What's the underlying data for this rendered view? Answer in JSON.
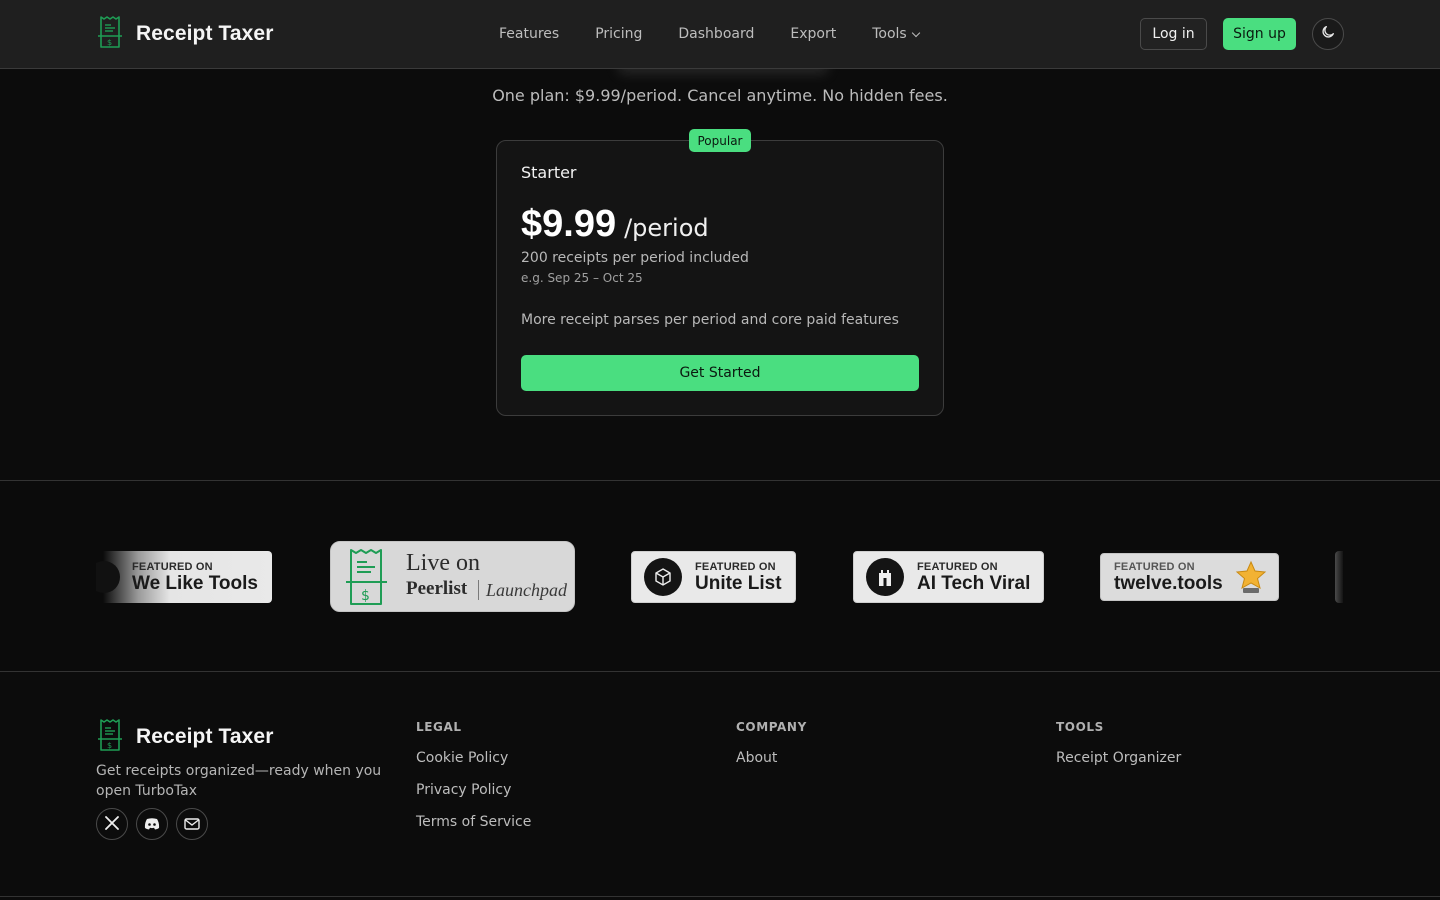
{
  "nav": {
    "brand": "Receipt Taxer",
    "links": [
      "Features",
      "Pricing",
      "Dashboard",
      "Export",
      "Tools"
    ],
    "login": "Log in",
    "signup": "Sign up",
    "theme_icon": "moon-icon"
  },
  "pricing": {
    "subtitle": "One plan: $9.99/period. Cancel anytime. No hidden fees.",
    "badge": "Popular",
    "plan": "Starter",
    "price": "$9.99",
    "period": "/period",
    "included": "200 receipts per period included",
    "example": "e.g. Sep 25 – Oct 25",
    "features": "More receipt parses per period and core paid features",
    "cta": "Get Started"
  },
  "featured": {
    "welike": {
      "small": "FEATURED ON",
      "big": "We Like Tools"
    },
    "peerlist": {
      "live": "Live on",
      "name": "Peerlist",
      "launch": "Launchpad"
    },
    "unite": {
      "small": "FEATURED ON",
      "big": "Unite List"
    },
    "aitech": {
      "small": "FEATURED ON",
      "big": "AI Tech Viral"
    },
    "twelve": {
      "small": "FEATURED ON",
      "big": "twelve.tools"
    }
  },
  "footer": {
    "brand": "Receipt Taxer",
    "tagline": "Get receipts organized—ready when you open TurboTax",
    "socials": [
      "x-icon",
      "discord-icon",
      "mail-icon"
    ],
    "legal": {
      "heading": "LEGAL",
      "links": [
        "Cookie Policy",
        "Privacy Policy",
        "Terms of Service"
      ]
    },
    "company": {
      "heading": "COMPANY",
      "links": [
        "About"
      ]
    },
    "tools": {
      "heading": "TOOLS",
      "links": [
        "Receipt Organizer"
      ]
    }
  },
  "colors": {
    "accent": "#4ade80",
    "background": "#0c0c0c",
    "nav_bg": "#1f1f1f"
  }
}
